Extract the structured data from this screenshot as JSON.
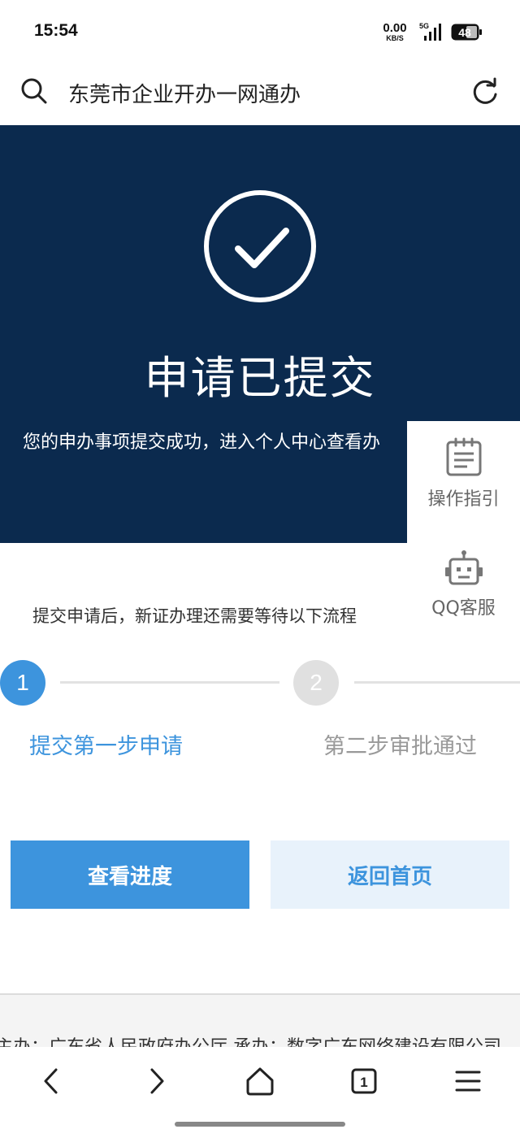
{
  "status_bar": {
    "time": "15:54",
    "net_speed_value": "0.00",
    "net_speed_unit": "KB/S",
    "network_type": "5G",
    "battery_level": "48",
    "icons": [
      "signal-icon",
      "battery-icon"
    ]
  },
  "address_bar": {
    "title": "东莞市企业开办一网通办",
    "icons": [
      "search-icon",
      "reload-icon"
    ]
  },
  "hero": {
    "title": "申请已提交",
    "subtitle": "您的申办事项提交成功，进入个人中心查看办",
    "icon": "check-circle-icon",
    "background_color": "#0b2a4e"
  },
  "side_panel": {
    "guide_label": "操作指引",
    "service_label": "QQ客服",
    "icons": [
      "notepad-icon",
      "robot-icon"
    ]
  },
  "process_note": "提交申请后，新证办理还需要等待以下流程",
  "steps": [
    {
      "number": "1",
      "label": "提交第一步申请",
      "active": true
    },
    {
      "number": "2",
      "label": "第二步审批通过",
      "active": false
    }
  ],
  "buttons": {
    "progress": "查看进度",
    "home": "返回首页"
  },
  "footer": {
    "text": "主办：广东省人民政府办公厅    承办：数字广东网络建设有限公司"
  },
  "nav_bar": {
    "tab_count": "1",
    "icons": [
      "back-icon",
      "forward-icon",
      "home-icon",
      "tabs-icon",
      "menu-icon"
    ]
  },
  "colors": {
    "accent": "#3d94dd",
    "accent_light": "#e8f2fb",
    "hero_bg": "#0b2a4e",
    "inactive": "#e0e0e0"
  }
}
